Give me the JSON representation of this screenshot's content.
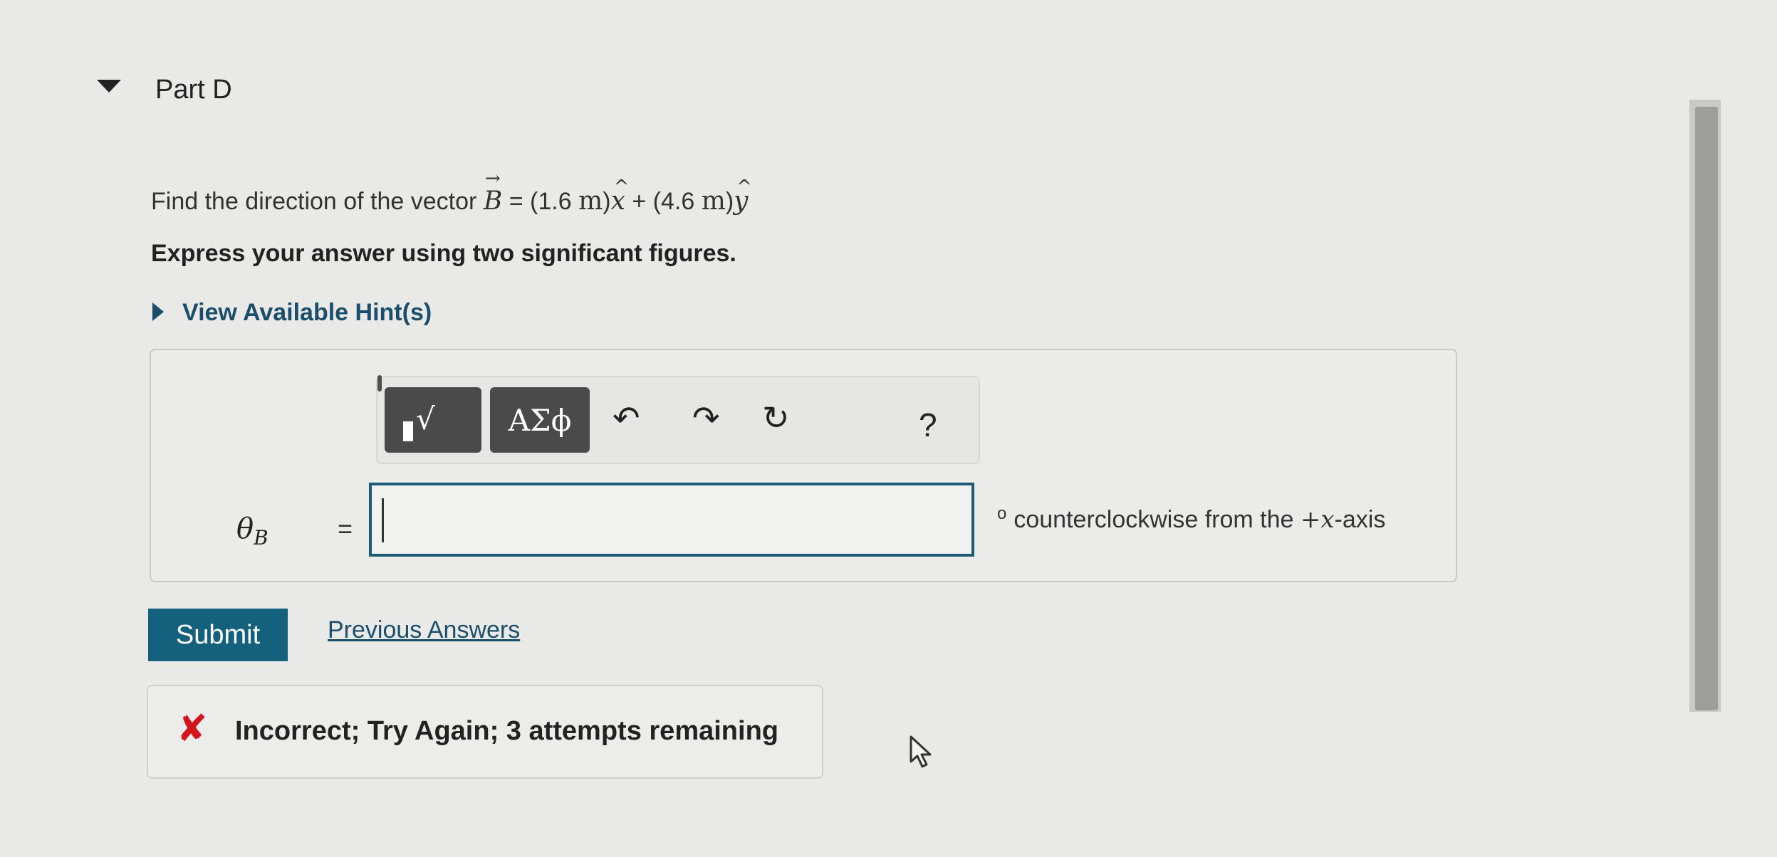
{
  "part": {
    "title": "Part D"
  },
  "question": {
    "prefix": "Find the direction of the vector",
    "vector_symbol": "B",
    "eq": "=",
    "open1": "(1.6",
    "unit1": "m",
    "close1": ")",
    "xhat": "x",
    "plus": "+",
    "open2": "(4.6",
    "unit2": "m",
    "close2": ")",
    "yhat": "y"
  },
  "instruction": "Express your answer using two significant figures.",
  "hints": {
    "label": "View Available Hint(s)"
  },
  "toolbar": {
    "templates_glyph": "√",
    "greek_label": "ΑΣϕ",
    "undo_glyph": "↶",
    "redo_glyph": "↷",
    "reset_glyph": "↻",
    "help_label": "?"
  },
  "answer": {
    "variable": "θ",
    "variable_sub": "B",
    "equals": "=",
    "value": "",
    "degree": "o",
    "unit_text": "counterclockwise from the",
    "axis_sign": "+",
    "axis_var": "x",
    "axis_suffix": "-axis"
  },
  "actions": {
    "submit_label": "Submit",
    "previous_answers_label": "Previous Answers"
  },
  "feedback": {
    "icon": "✘",
    "message": "Incorrect; Try Again; 3 attempts remaining"
  },
  "colors": {
    "accent": "#14617e",
    "link": "#1b4e6b",
    "error": "#d1171b"
  }
}
